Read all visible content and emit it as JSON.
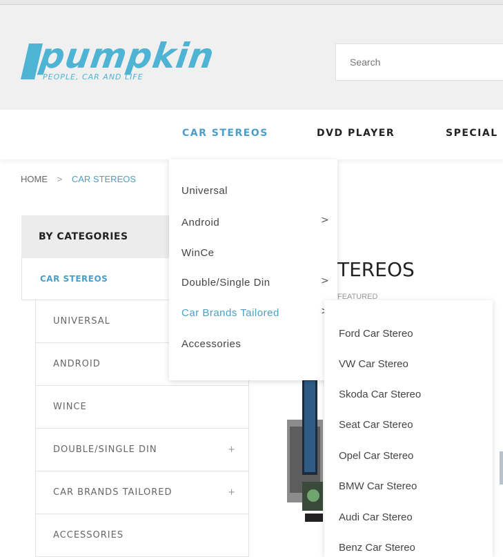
{
  "header": {
    "logo_text": "pumpkin",
    "logo_tagline": "PEOPLE, CAR AND LIFE",
    "search_placeholder": "Search"
  },
  "nav": {
    "items": [
      {
        "label": "CAR STEREOS",
        "active": true
      },
      {
        "label": "DVD PLAYER",
        "active": false
      },
      {
        "label": "SPECIAL",
        "active": false
      }
    ]
  },
  "breadcrumb": {
    "home": "HOME",
    "separator": ">",
    "current": "CAR STEREOS"
  },
  "sidebar": {
    "title": "BY CATEGORIES",
    "current": "CAR STEREOS",
    "items": [
      {
        "label": "UNIVERSAL",
        "expand": ""
      },
      {
        "label": "ANDROID",
        "expand": ""
      },
      {
        "label": "WINCE",
        "expand": ""
      },
      {
        "label": "DOUBLE/SINGLE DIN",
        "expand": "+"
      },
      {
        "label": "CAR BRANDS TAILORED",
        "expand": "+"
      },
      {
        "label": "ACCESSORIES",
        "expand": ""
      }
    ]
  },
  "main": {
    "heading": "TEREOS",
    "featured": "FEATURED"
  },
  "dropdown": {
    "items": [
      {
        "label": "Universal",
        "arrow": ""
      },
      {
        "label": "Android",
        "arrow": ">"
      },
      {
        "label": "WinCe",
        "arrow": ""
      },
      {
        "label": "Double/Single Din",
        "arrow": ">"
      },
      {
        "label": "Car Brands Tailored",
        "arrow": ">"
      },
      {
        "label": "Accessories",
        "arrow": ""
      }
    ]
  },
  "subdropdown": {
    "items": [
      "Ford Car Stereo",
      "VW Car Stereo",
      "Skoda Car Stereo",
      "Seat Car Stereo",
      "Opel Car Stereo",
      "BMW Car Stereo",
      "Audi Car Stereo",
      "Benz Car Stereo"
    ]
  },
  "colors": {
    "accent": "#4a9ec9",
    "logo": "#4fb3d3",
    "header_bg": "#f0f0f0"
  }
}
